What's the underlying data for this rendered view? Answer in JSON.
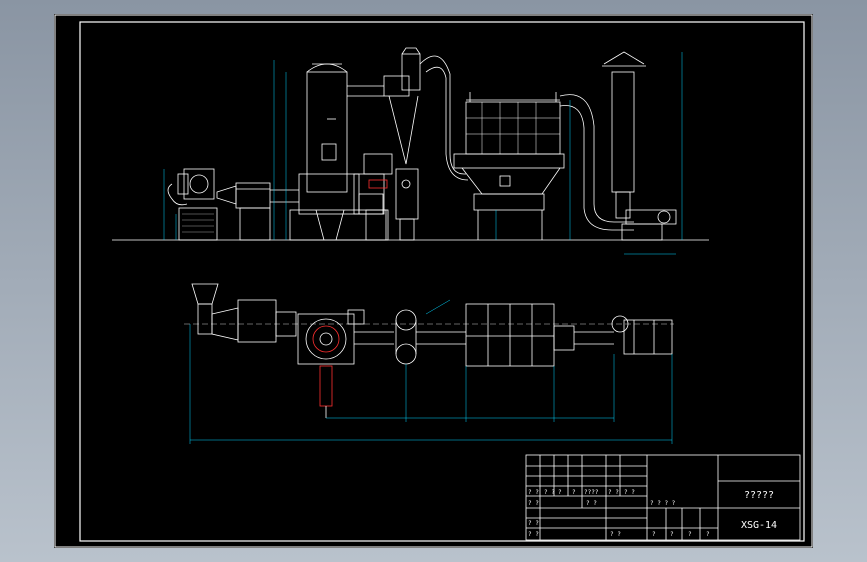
{
  "drawing": {
    "title_block": {
      "drawing_name": "?????",
      "drawing_number": "XSG-14",
      "header_cells": [
        "? ?",
        "? ?",
        "?",
        "?",
        "????",
        "? ?",
        "? ?"
      ],
      "mid_cells": [
        "? ? ? ?",
        "? ?"
      ],
      "left_cells": [
        "? ?",
        "? ?",
        "? ?",
        "? ?"
      ],
      "bottom_cells": [
        "?",
        "?",
        "?",
        "?"
      ]
    },
    "colors": {
      "background": "#000000",
      "line": "#ffffff",
      "dimension": "#00d4ff",
      "accent_red": "#ff3030",
      "accent_yellow": "#ffff00"
    }
  }
}
